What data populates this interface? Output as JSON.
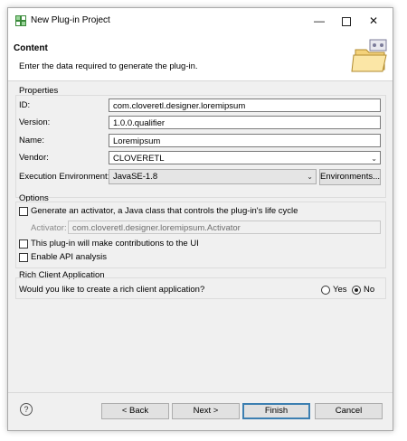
{
  "window": {
    "title": "New Plug-in Project",
    "controls": {
      "minimize": "—",
      "maximize": "",
      "close": "✕"
    }
  },
  "header": {
    "title": "Content",
    "description": "Enter the data required to generate the plug-in."
  },
  "properties": {
    "group_label": "Properties",
    "id_label": "ID:",
    "id_value": "com.cloveretl.designer.loremipsum",
    "version_label": "Version:",
    "version_value": "1.0.0.qualifier",
    "name_label": "Name:",
    "name_value": "Loremipsum",
    "vendor_label": "Vendor:",
    "vendor_value": "CLOVERETL",
    "env_label": "Execution Environment:",
    "env_value": "JavaSE-1.8",
    "environments_button": "Environments..."
  },
  "options": {
    "group_label": "Options",
    "activator_check_label": "Generate an activator, a Java class that controls the plug-in's life cycle",
    "activator_check_checked": false,
    "activator_label": "Activator:",
    "activator_value": "com.cloveretl.designer.loremipsum.Activator",
    "ui_check_label": "This plug-in will make contributions to the UI",
    "ui_check_checked": false,
    "api_check_label": "Enable API analysis",
    "api_check_checked": false
  },
  "rca": {
    "group_label": "Rich Client Application",
    "question": "Would you like to create a rich client application?",
    "yes_label": "Yes",
    "no_label": "No",
    "selected": "No"
  },
  "footer": {
    "help_icon": "?",
    "back_button": "< Back",
    "next_button": "Next >",
    "finish_button": "Finish",
    "cancel_button": "Cancel"
  }
}
